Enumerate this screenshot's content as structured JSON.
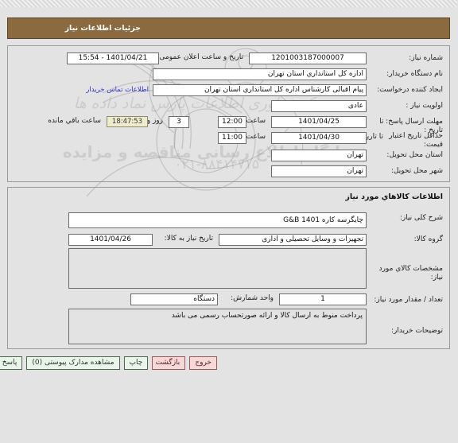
{
  "header": {
    "title": "جزئیات اطلاعات نیاز"
  },
  "section_one": {
    "rows": {
      "need_number_label": "شماره نیاز:",
      "need_number_value": "1201003187000007",
      "announce_label": "تاریخ و ساعت اعلان عمومی:",
      "announce_value": "1401/04/21 - 15:54",
      "buyer_org_label": "نام دستگاه خریدار:",
      "buyer_org_value": "اداره کل استانداري استان تهران",
      "creator_label": "ایجاد کننده درخواست:",
      "creator_value": "پیام اقبالی کارشناس اداره کل استانداري استان تهران",
      "contact_link": "اطلاعات تماس خریدار",
      "priority_label": "اولویت نیاز :",
      "priority_value": "عادی",
      "reply_deadline_label": "مهلت ارسال پاسخ: تا تاریخ :",
      "reply_deadline_date": "1401/04/25",
      "hour_label": "ساعت",
      "reply_deadline_time": "12:00",
      "days_remaining": "3",
      "days_and_label": "روز و",
      "countdown": "18:47:53",
      "remaining_suffix": "ساعت باقي مانده",
      "price_validity_label": "حداقل تاریخ اعتبار قیمت:",
      "price_validity_to_label": "تا تاریخ :",
      "price_validity_date": "1401/04/30",
      "price_validity_time": "11:00",
      "province_label": "استان محل تحویل:",
      "province_value": "تهران",
      "city_label": "شهر محل تحویل:",
      "city_value": "تهران"
    }
  },
  "section_two": {
    "title": "اطلاعات کالاهاي مورد نیاز",
    "rows": {
      "general_desc_label": "شرح کلی نیاز:",
      "general_desc_value": "چایگرسه کاره G&B 1401",
      "goods_group_label": "گروه کالا:",
      "goods_group_value": "تجهیزات و وسایل تحصیلی و اداری",
      "need_date_label": "تاریخ نیاز به کالا:",
      "need_date_value": "1401/04/26",
      "specs_label": "مشخصات کالاي مورد نیاز:",
      "specs_value": "",
      "quantity_label": "تعداد / مقدار مورد نیاز:",
      "quantity_value": "1",
      "unit_label": "واحد شمارش:",
      "unit_value": "دستگاه",
      "buyer_notes_label": "توضیحات خریدار:",
      "buyer_notes_value": "پرداخت منوط به ارسال کالا و ارائه صورتحساب رسمی می باشد"
    }
  },
  "footer": {
    "buttons": [
      {
        "label": "خروج",
        "kind": "danger"
      },
      {
        "label": "بازگشت",
        "kind": "danger"
      },
      {
        "label": "چاپ",
        "kind": "normal"
      },
      {
        "label": "مشاهده مدارک پیوستی (0)",
        "kind": "normal"
      },
      {
        "label": "پاسخ به نیاز",
        "kind": "normal"
      }
    ]
  },
  "watermark": {
    "line_one": "مرکز فرآوری اطلاعات پارس نماد داده ها",
    "line_two": "پایگاه اطلاع رسانی مناقصه و مزایده",
    "phone": "۰۲۱-۸۸۴۱۴۷۱۵"
  },
  "colors": {
    "header_bg": "#8a6a3e",
    "page_bg": "#e3e3e3",
    "link": "#2a2ad0",
    "countdown_bg": "#efeccd",
    "btn_ok_bg": "#eaf4ea",
    "btn_danger_bg": "#f6d8d8"
  }
}
